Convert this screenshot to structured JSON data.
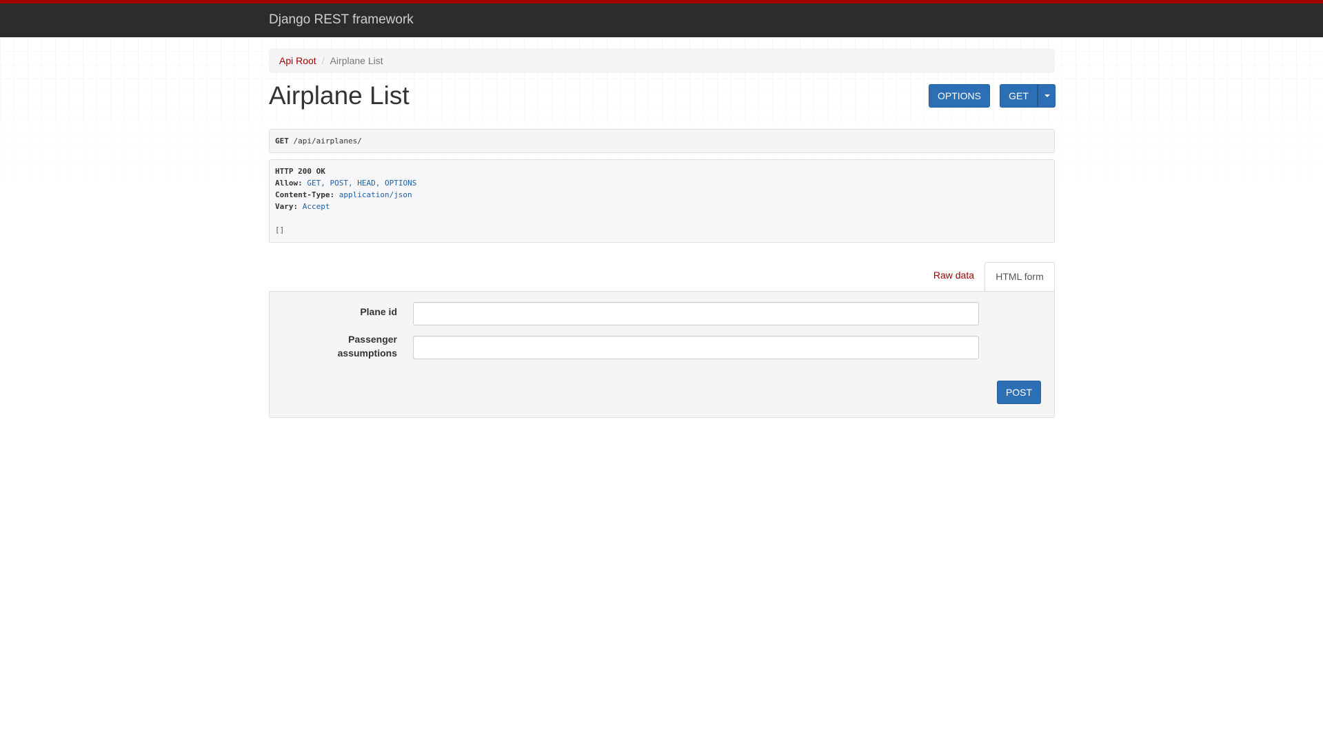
{
  "navbar": {
    "brand": "Django REST framework"
  },
  "breadcrumb": {
    "root_label": "Api Root",
    "separator": "/",
    "current_label": "Airplane List"
  },
  "page": {
    "title": "Airplane List"
  },
  "toolbar": {
    "options_label": "OPTIONS",
    "get_label": "GET"
  },
  "request": {
    "method": "GET",
    "path": "/api/airplanes/"
  },
  "response": {
    "status_line": "HTTP 200 OK",
    "headers": [
      {
        "name": "Allow:",
        "value": "GET, POST, HEAD, OPTIONS"
      },
      {
        "name": "Content-Type:",
        "value": "application/json"
      },
      {
        "name": "Vary:",
        "value": "Accept"
      }
    ],
    "body": "[]"
  },
  "tabs": {
    "raw_label": "Raw data",
    "html_label": "HTML form"
  },
  "form": {
    "fields": [
      {
        "label": "Plane id",
        "value": ""
      },
      {
        "label_line1": "Passenger",
        "label_line2": "assumptions",
        "value": ""
      }
    ],
    "submit_label": "POST"
  },
  "colors": {
    "accent_red": "#a30000",
    "button_blue": "#2c6fb5",
    "navbar_bg": "#2c2c2c"
  }
}
